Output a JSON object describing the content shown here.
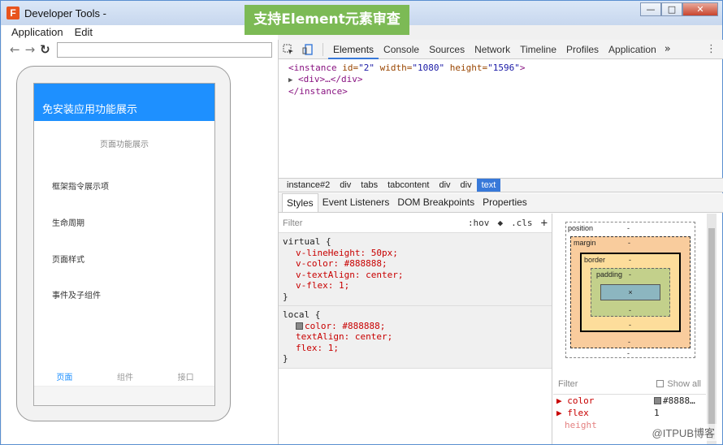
{
  "window": {
    "app_logo": "F",
    "title": "Developer Tools -",
    "buttons": {
      "minimize": "—",
      "maximize": "□",
      "close": "✕"
    }
  },
  "banner": "支持Element元素审查",
  "menubar": [
    "Application",
    "Edit"
  ],
  "nav": {
    "back": "←",
    "forward": "→",
    "reload": "↻",
    "url_value": ""
  },
  "phone": {
    "header_title": "免安装应用功能展示",
    "subtitle": "页面功能展示",
    "items": [
      "框架指令展示项",
      "生命周期",
      "页面样式",
      "事件及子组件"
    ],
    "tabs": [
      "页面",
      "组件",
      "接口"
    ]
  },
  "devtools": {
    "tool_icons": [
      "inspect-icon",
      "device-icon"
    ],
    "tabs": [
      "Elements",
      "Console",
      "Sources",
      "Network",
      "Timeline",
      "Profiles",
      "Application"
    ],
    "active_tab": "Elements",
    "more": "»",
    "kebab": "⋮",
    "dom": {
      "line1": {
        "tag_open": "<instance",
        "attr1": " id=",
        "val1": "\"2\"",
        "attr2": " width=",
        "val2": "\"1080\"",
        "attr3": " height=",
        "val3": "\"1596\"",
        "tag_close": ">"
      },
      "line2": {
        "arrow": "▶",
        "tag": "<div>…</div>"
      },
      "line3": {
        "tag": "</instance>"
      }
    },
    "breadcrumbs": [
      "instance#2",
      "div",
      "tabs",
      "tabcontent",
      "div",
      "div",
      "text"
    ],
    "selected_crumb": "text",
    "sub_tabs": [
      "Styles",
      "Event Listeners",
      "DOM Breakpoints",
      "Properties"
    ],
    "styles": {
      "filter_placeholder": "Filter",
      "hov": ":hov",
      "cls": ".cls",
      "plus": "+",
      "rule1": {
        "selector": "virtual {",
        "props": [
          "v-lineHeight: 50px;",
          "v-color: #888888;",
          "v-textAlign: center;",
          "v-flex: 1;"
        ],
        "close": "}"
      },
      "rule2": {
        "selector": "local {",
        "props": [
          "color: #888888;",
          "textAlign: center;",
          "flex: 1;"
        ],
        "close": "}"
      }
    },
    "box_model": {
      "position": "position",
      "margin": "margin",
      "border": "border",
      "padding": "padding",
      "dash": "-",
      "content": "×"
    },
    "computed": {
      "filter_placeholder": "Filter",
      "show_all": "Show all",
      "rows": [
        {
          "k": "color",
          "v": "#8888…"
        },
        {
          "k": "flex",
          "v": "1"
        },
        {
          "k": "height",
          "v": ""
        }
      ]
    }
  },
  "watermark": "@ITPUB博客",
  "colors": {
    "accent": "#3879d9",
    "phone_header": "#1e90ff",
    "banner": "#7cba55"
  }
}
